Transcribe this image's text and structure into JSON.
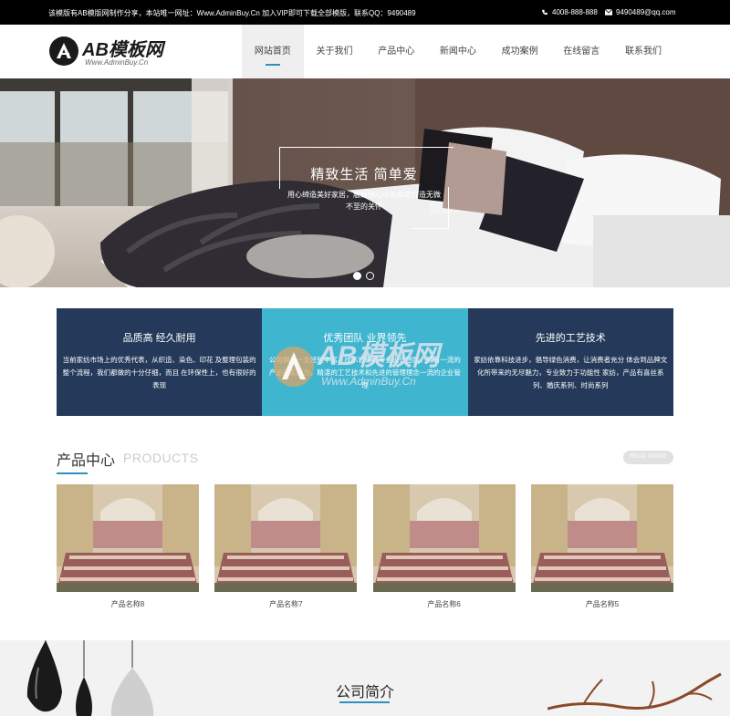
{
  "topbar": {
    "notice": "该模版有AB模版网制作分享，本站唯一网址：Www.AdminBuy.Cn 加入VIP即可下载全部模版，联系QQ：9490489",
    "phone": "4008-888-888",
    "email": "9490489@qq.com",
    "phone_icon": "phone-icon",
    "email_icon": "mail-icon"
  },
  "logo": {
    "name": "AB模板网",
    "subtitle": "Www.AdminBuy.Cn"
  },
  "nav": {
    "items": [
      "网站首页",
      "关于我们",
      "产品中心",
      "新闻中心",
      "成功案例",
      "在线留言",
      "联系我们"
    ],
    "active_index": 0
  },
  "banner": {
    "title": "精致生活 简单爱",
    "subtitle": "用心缔造美好家居，触碰你心中的柔软打造无微不至的关怀",
    "slides": 2,
    "active_slide": 0
  },
  "features": [
    {
      "title": "品质高 经久耐用",
      "text": "当前家纺市场上的优秀代表，从织造、染色、印花 及整理包装的整个流程，我们都做的十分仔细，而且 在环保性上，也有很好的表现"
    },
    {
      "title": "优秀团队 业界领先",
      "text": "公司拥有一支经验丰富、技术过硬的专业设计团队，拥有一流的产品研发能力，精湛的工艺技术和先进的管理理念一流的企业管理"
    },
    {
      "title": "先进的工艺技术",
      "text": "家纺依靠科技进步，倡导绿色消费，让消费者充分 体会到品牌文化所带来的无尽魅力，专业致力于功能性 家纺，产品有喜丝系列、婚庆系列、时尚系列"
    }
  ],
  "watermark": {
    "name": "AB模板网",
    "url": "Www.AdminBuy.Cn"
  },
  "products": {
    "title_cn": "产品中心",
    "title_en": "PRODUCTS",
    "more": "READ MORE",
    "items": [
      {
        "name": "产品名称8"
      },
      {
        "name": "产品名称7"
      },
      {
        "name": "产品名称6"
      },
      {
        "name": "产品名称5"
      }
    ]
  },
  "about": {
    "title": "公司简介"
  },
  "colors": {
    "accent": "#2f8fbf",
    "feature_dark": "#253a5a",
    "feature_light": "#3fb5d0",
    "topbar": "#000000"
  }
}
